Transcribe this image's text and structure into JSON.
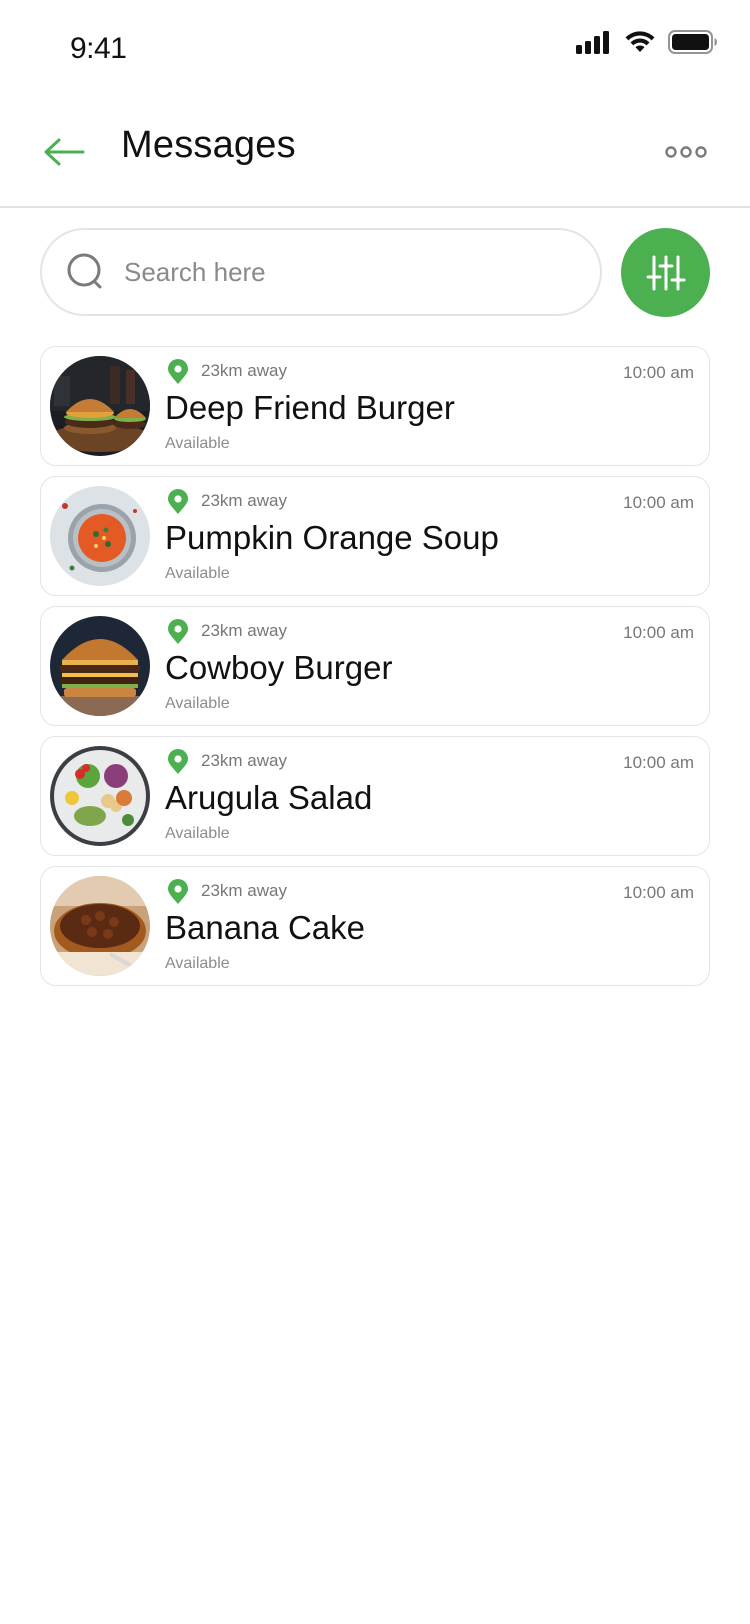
{
  "status_bar": {
    "time": "9:41",
    "icons": [
      "cellular-signal-icon",
      "wifi-icon",
      "battery-icon"
    ]
  },
  "header": {
    "back_icon": "arrow-left-icon",
    "title": "Messages",
    "more_icon": "more-horizontal-icon"
  },
  "search": {
    "placeholder": "Search here",
    "value": "",
    "icon": "search-icon",
    "filter_icon": "sliders-icon"
  },
  "colors": {
    "accent": "#4caf50",
    "text_primary": "#111111",
    "text_secondary": "#777777",
    "border": "#e4e4e4"
  },
  "items": [
    {
      "distance": "23km away",
      "time": "10:00 am",
      "name": "Deep Friend Burger",
      "status": "Available",
      "image": "burger-photo"
    },
    {
      "distance": "23km away",
      "time": "10:00 am",
      "name": "Pumpkin Orange Soup",
      "status": "Available",
      "image": "soup-photo"
    },
    {
      "distance": "23km away",
      "time": "10:00 am",
      "name": "Cowboy Burger",
      "status": "Available",
      "image": "burger-photo"
    },
    {
      "distance": "23km away",
      "time": "10:00 am",
      "name": "Arugula Salad",
      "status": "Available",
      "image": "salad-photo"
    },
    {
      "distance": "23km away",
      "time": "10:00 am",
      "name": "Banana Cake",
      "status": "Available",
      "image": "cake-photo"
    }
  ]
}
